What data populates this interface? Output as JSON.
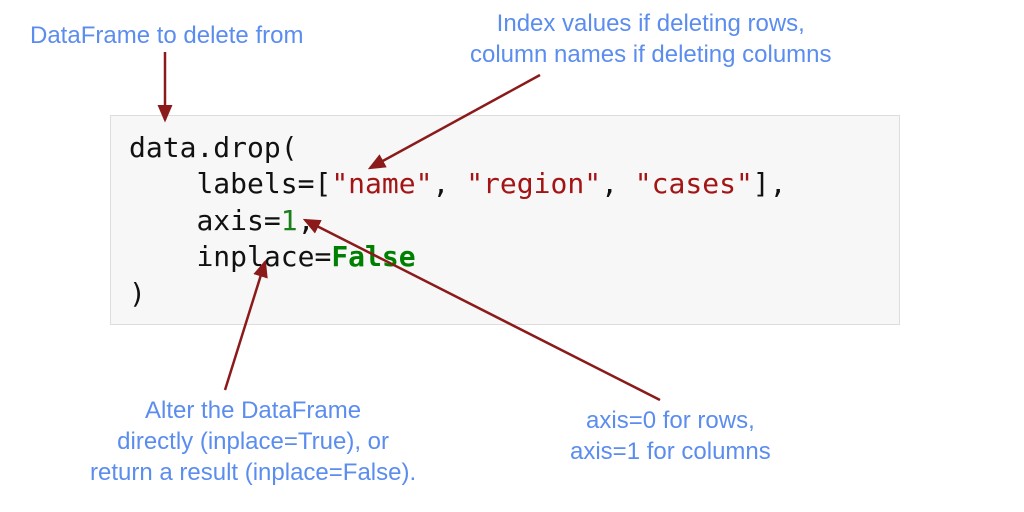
{
  "annotations": {
    "dataframe_note": "DataFrame to delete from",
    "labels_note": "Index values if deleting rows,\ncolumn names if deleting columns",
    "inplace_note": "Alter the DataFrame\ndirectly (inplace=True), or\nreturn a result (inplace=False).",
    "axis_note": "axis=0 for rows,\naxis=1 for columns"
  },
  "code": {
    "obj": "data",
    "dot": ".",
    "method": "drop",
    "open_paren": "(",
    "indent": "    ",
    "labels_kw": "labels",
    "eq": "=",
    "lbracket": "[",
    "q": "\"",
    "label1": "name",
    "comma_sp": ", ",
    "label2": "region",
    "label3": "cases",
    "rbracket": "]",
    "comma": ",",
    "axis_kw": "axis",
    "axis_val": "1",
    "inplace_kw": "inplace",
    "inplace_val": "False",
    "close_paren": ")"
  },
  "colors": {
    "annotation": "#5b8def",
    "arrow": "#8b1a1a",
    "code_bg": "#f7f7f7",
    "code_border": "#dddddd",
    "string": "#a31515",
    "number": "#1a7f1a",
    "boolean": "#008000"
  }
}
